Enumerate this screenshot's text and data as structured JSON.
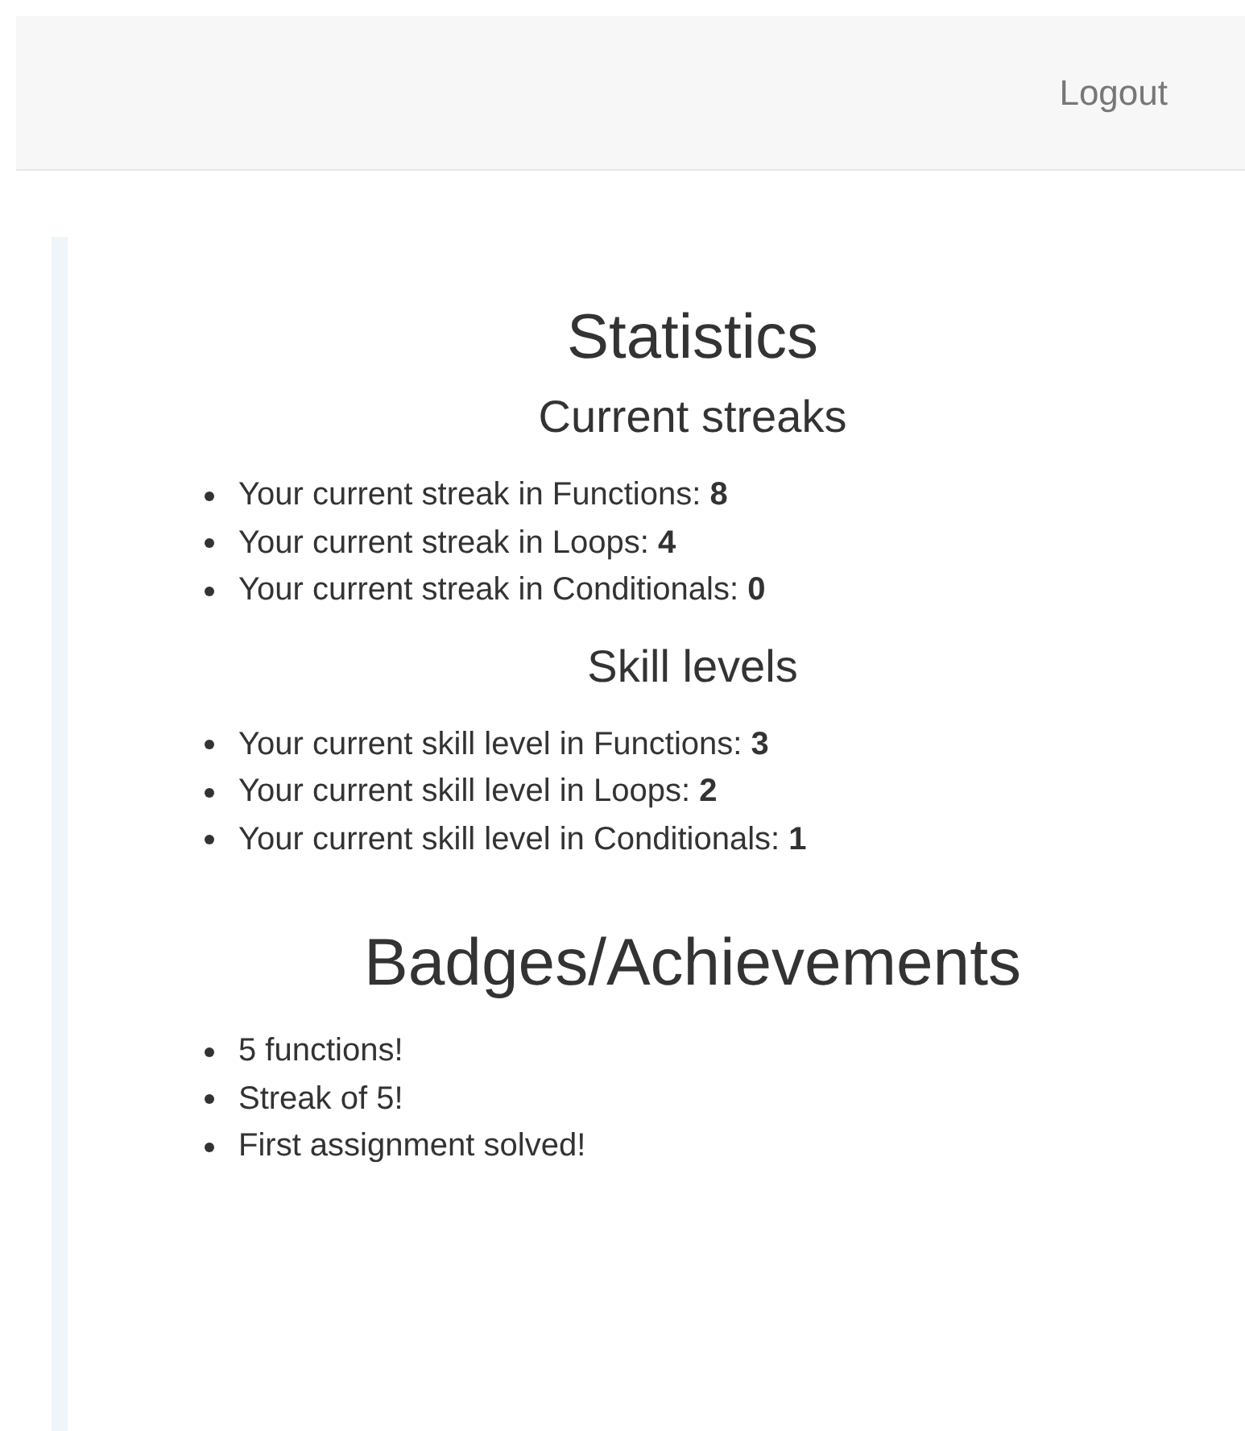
{
  "navbar": {
    "logout": "Logout"
  },
  "statistics": {
    "title": "Statistics",
    "sections": [
      {
        "heading": "Current streaks",
        "items": [
          "Your current streak in Functions: **8**",
          "Your current streak in Loops: **4**",
          "Your current streak in Conditionals: **0**"
        ]
      },
      {
        "heading": "Skill levels",
        "items": [
          "Your current skill level in Functions: **3**",
          "Your current skill level in Loops: **2**",
          "Your current skill level in Conditionals: **1**"
        ]
      }
    ]
  },
  "badges": {
    "title": "Badges/Achievements",
    "items": [
      "5 functions!",
      "Streak of 5!",
      "First assignment solved!"
    ]
  }
}
